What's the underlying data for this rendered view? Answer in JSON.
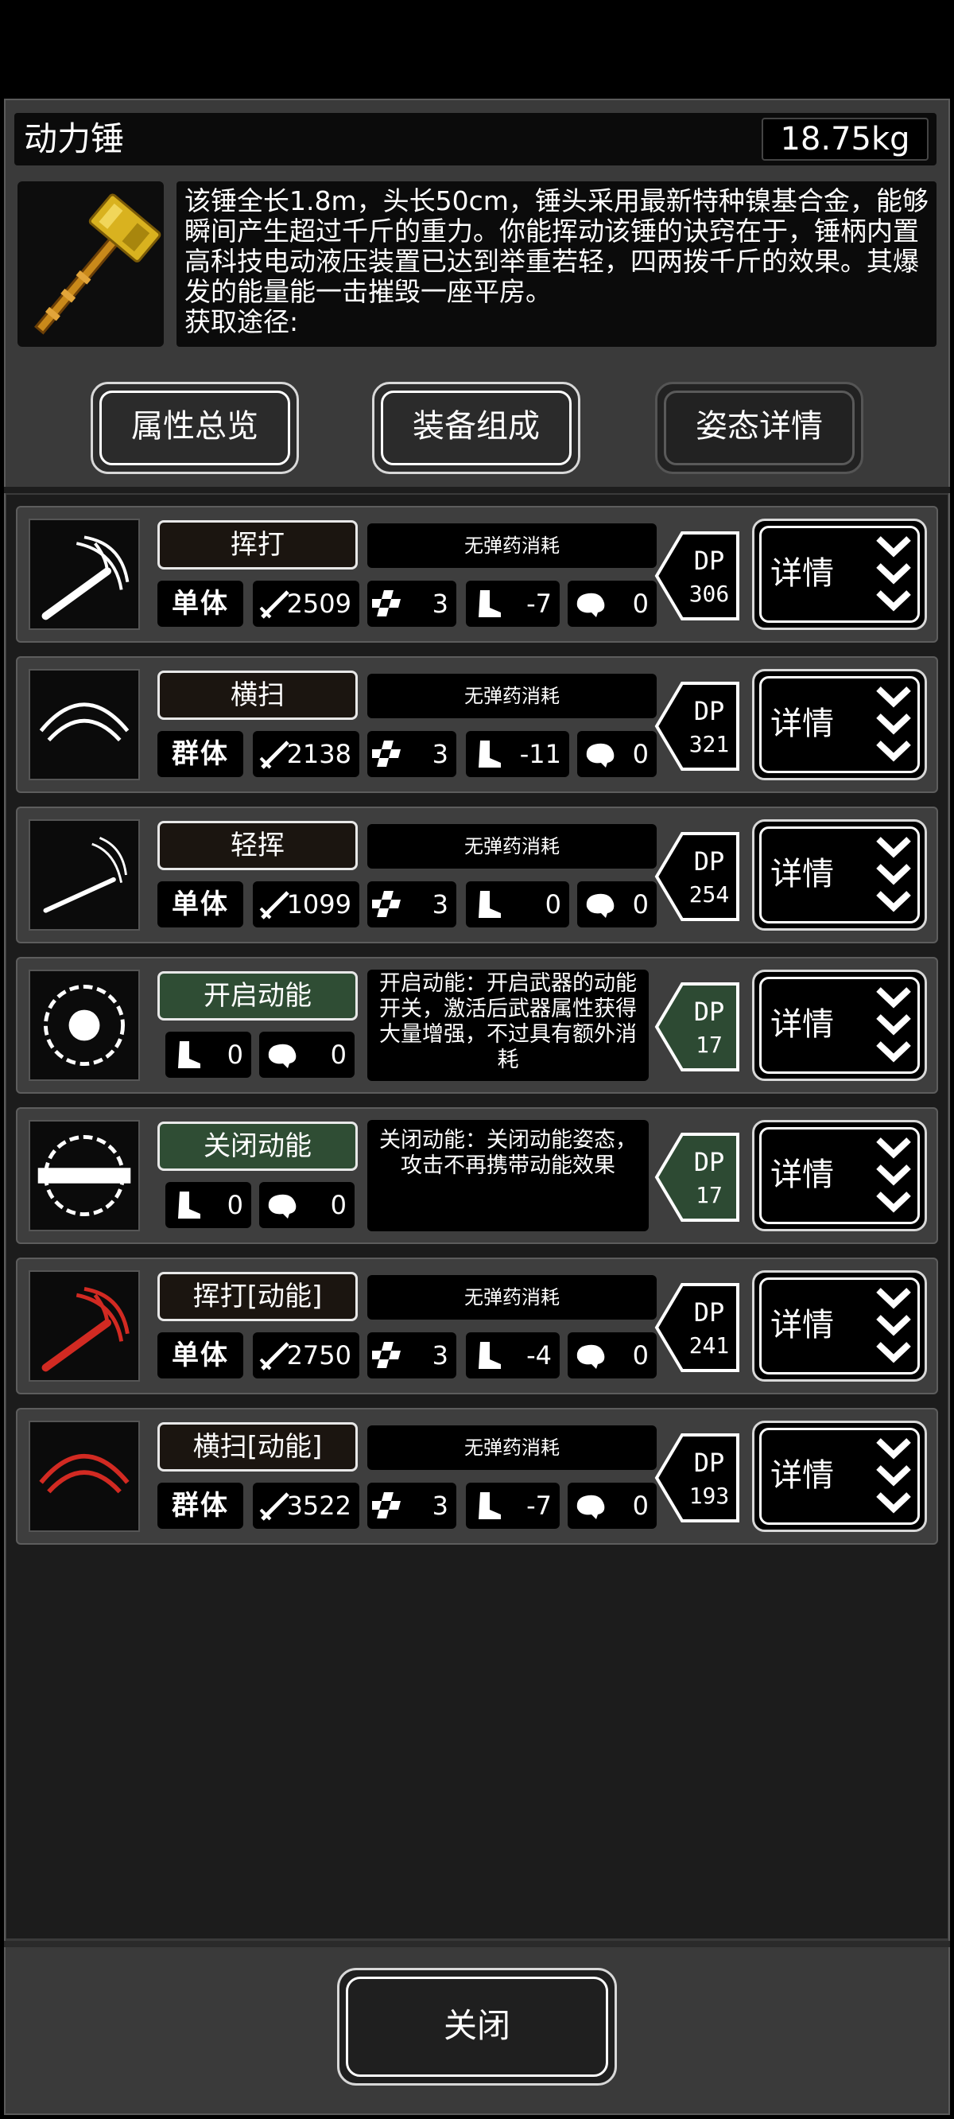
{
  "header": {
    "title": "动力锤",
    "weight": "18.75kg"
  },
  "item": {
    "icon": "power-hammer-icon",
    "description_lines": [
      "该锤全长1.8m，头长50cm，锤头采用最新特种镍基合金，能够",
      "瞬间产生超过千斤的重力。你能挥动该锤的诀窍在于，锤柄内置",
      "高科技电动液压装置已达到举重若轻，四两拨千斤的效果。其爆",
      "发的能量能一击摧毁一座平房。",
      "获取途径:"
    ]
  },
  "tabs": [
    {
      "label": "属性总览",
      "active": false
    },
    {
      "label": "装备组成",
      "active": false
    },
    {
      "label": "姿态详情",
      "active": true
    }
  ],
  "skills": [
    {
      "name": "挥打",
      "style": "normal",
      "icon": "swing-icon",
      "ammo": "无弹药消耗",
      "target": "单体",
      "attack": "2509",
      "hits": "3",
      "move": "-7",
      "brain": "0",
      "dp": "306",
      "dp_color": "#000000",
      "detail": "详情"
    },
    {
      "name": "横扫",
      "style": "normal",
      "icon": "sweep-icon",
      "ammo": "无弹药消耗",
      "target": "群体",
      "attack": "2138",
      "hits": "3",
      "move": "-11",
      "brain": "0",
      "dp": "321",
      "dp_color": "#000000",
      "detail": "详情"
    },
    {
      "name": "轻挥",
      "style": "normal",
      "icon": "light-swing-icon",
      "ammo": "无弹药消耗",
      "target": "单体",
      "attack": "1099",
      "hits": "3",
      "move": "0",
      "brain": "0",
      "dp": "254",
      "dp_color": "#000000",
      "detail": "详情"
    },
    {
      "name": "开启动能",
      "style": "toggle",
      "icon": "power-on-icon",
      "desc": "开启动能：开启武器的动能开关，激活后武器属性获得大量增强，不过具有额外消耗",
      "move": "0",
      "brain": "0",
      "dp": "17",
      "dp_color": "#2d4a33",
      "detail": "详情"
    },
    {
      "name": "关闭动能",
      "style": "toggle",
      "icon": "power-off-icon",
      "desc": "关闭动能：关闭动能姿态，攻击不再携带动能效果",
      "move": "0",
      "brain": "0",
      "dp": "17",
      "dp_color": "#2d4a33",
      "detail": "详情"
    },
    {
      "name": "挥打[动能]",
      "style": "normal",
      "icon": "swing-powered-icon",
      "ammo": "无弹药消耗",
      "target": "单体",
      "attack": "2750",
      "hits": "3",
      "move": "-4",
      "brain": "0",
      "dp": "241",
      "dp_color": "#000000",
      "detail": "详情"
    },
    {
      "name": "横扫[动能]",
      "style": "normal",
      "icon": "sweep-powered-icon",
      "ammo": "无弹药消耗",
      "target": "群体",
      "attack": "3522",
      "hits": "3",
      "move": "-7",
      "brain": "0",
      "dp": "193",
      "dp_color": "#000000",
      "detail": "详情"
    }
  ],
  "footer": {
    "close_label": "关闭"
  },
  "colors": {
    "panel": "#3a3a3a",
    "list_bg": "#1c1c1c",
    "toggle_green": "#2f4d34",
    "powered_red": "#d22a22"
  }
}
